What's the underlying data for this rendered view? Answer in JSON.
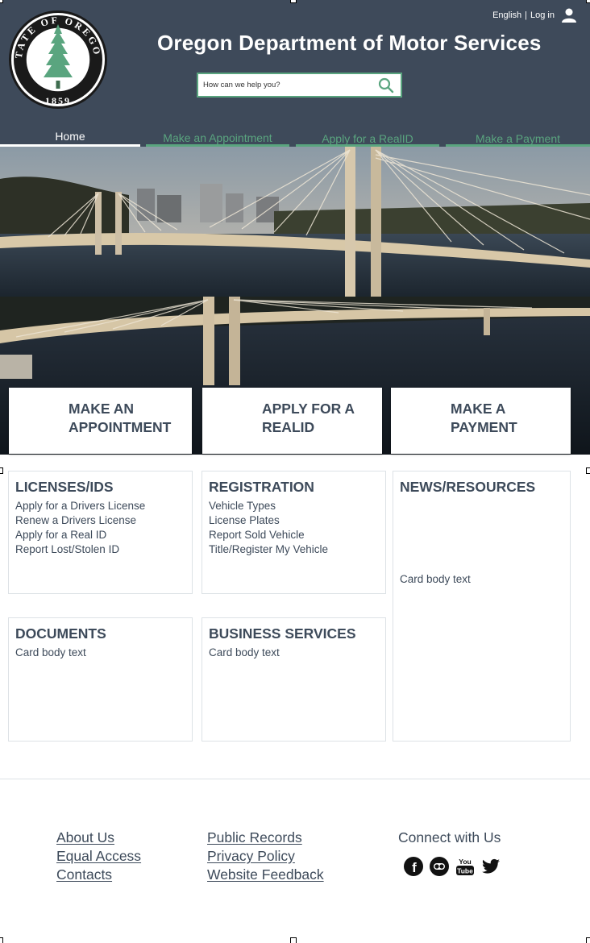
{
  "header": {
    "seal": {
      "top_text": "STATE OF OREGON",
      "year": "1859"
    },
    "language_label": "English",
    "separator": "|",
    "login_label": "Log in",
    "site_title": "Oregon Department of Motor Services",
    "search_placeholder": "How can we help you?"
  },
  "nav": {
    "tabs": [
      {
        "label": "Home",
        "active": true
      },
      {
        "label": "Make an Appointment",
        "active": false
      },
      {
        "label": "Apply for a RealID",
        "active": false
      },
      {
        "label": "Make a Payment",
        "active": false
      }
    ]
  },
  "actions": [
    {
      "line1": "MAKE AN",
      "line2": "APPOINTMENT"
    },
    {
      "line1": "APPLY FOR A",
      "line2": "REALID"
    },
    {
      "line1": "MAKE A",
      "line2": "PAYMENT"
    }
  ],
  "cards": {
    "licenses": {
      "title": "LICENSES/IDS",
      "links": [
        "Apply for a Drivers License",
        "Renew a Drivers License",
        "Apply for a Real ID",
        "Report Lost/Stolen ID"
      ]
    },
    "registration": {
      "title": "REGISTRATION",
      "links": [
        "Vehicle Types",
        "License Plates",
        "Report Sold Vehicle",
        "Title/Register My Vehicle"
      ]
    },
    "news": {
      "title": "NEWS/RESOURCES",
      "body": "Card body text"
    },
    "documents": {
      "title": "DOCUMENTS",
      "body": "Card body text"
    },
    "business": {
      "title": "BUSINESS SERVICES",
      "body": "Card body text"
    }
  },
  "footer": {
    "col1": [
      "About Us",
      "Equal Access",
      "Contacts"
    ],
    "col2": [
      "Public Records",
      "Privacy Policy",
      "Website Feedback"
    ],
    "connect_label": "Connect with Us",
    "social": [
      {
        "icon": "facebook-icon",
        "glyph": "f"
      },
      {
        "icon": "flickr-icon",
        "glyph": ""
      },
      {
        "icon": "youtube-icon",
        "glyph_top": "You",
        "glyph_bottom": "Tube"
      },
      {
        "icon": "twitter-icon",
        "glyph": ""
      }
    ]
  },
  "colors": {
    "header_bg": "#3e4a5a",
    "accent_green": "#5aa57f",
    "text_dark": "#3d4a5a",
    "card_border": "#dde2e6"
  }
}
